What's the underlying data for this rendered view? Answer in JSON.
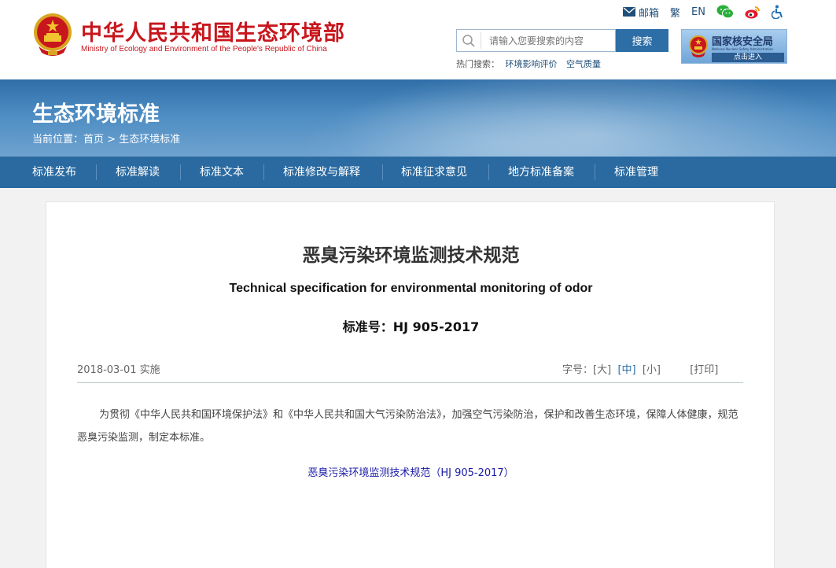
{
  "header": {
    "site_title": "中华人民共和国生态环境部",
    "site_subtitle": "Ministry of Ecology and Environment of the People's Republic of China",
    "toplinks": {
      "mail": "邮箱",
      "traditional": "繁",
      "english": "EN"
    },
    "search": {
      "placeholder": "请输入您要搜索的内容",
      "button": "搜索",
      "hot_label": "热门搜索：",
      "hot_items": [
        "环境影响评价",
        "空气质量"
      ]
    },
    "nna": {
      "title": "国家核安全局",
      "subtitle_en": "National Nuclear Safety Administration",
      "enter": "点击进入"
    }
  },
  "banner": {
    "title": "生态环境标准",
    "breadcrumb_prefix": "当前位置：",
    "breadcrumb_home": "首页",
    "breadcrumb_sep": ">",
    "breadcrumb_current": "生态环境标准"
  },
  "nav": [
    "标准发布",
    "标准解读",
    "标准文本",
    "标准修改与解释",
    "标准征求意见",
    "地方标准备案",
    "标准管理"
  ],
  "article": {
    "title": "恶臭污染环境监测技术规范",
    "title_en": "Technical specification for environmental monitoring of odor",
    "standard_no": "标准号：HJ 905-2017",
    "date": "2018-03-01 实施",
    "font_size_label": "字号：",
    "font_large": "[大]",
    "font_medium": "[中]",
    "font_small": "[小]",
    "print": "[打印]",
    "paragraph": "为贯彻《中华人民共和国环境保护法》和《中华人民共和国大气污染防治法》，加强空气污染防治，保护和改善生态环境，保障人体健康，规范恶臭污染监测，制定本标准。",
    "link": "恶臭污染环境监测技术规范（HJ 905-2017）"
  },
  "colors": {
    "brand_red": "#c8161d",
    "nav_blue": "#2a6aa0",
    "link_blue": "#1a1aa6"
  }
}
